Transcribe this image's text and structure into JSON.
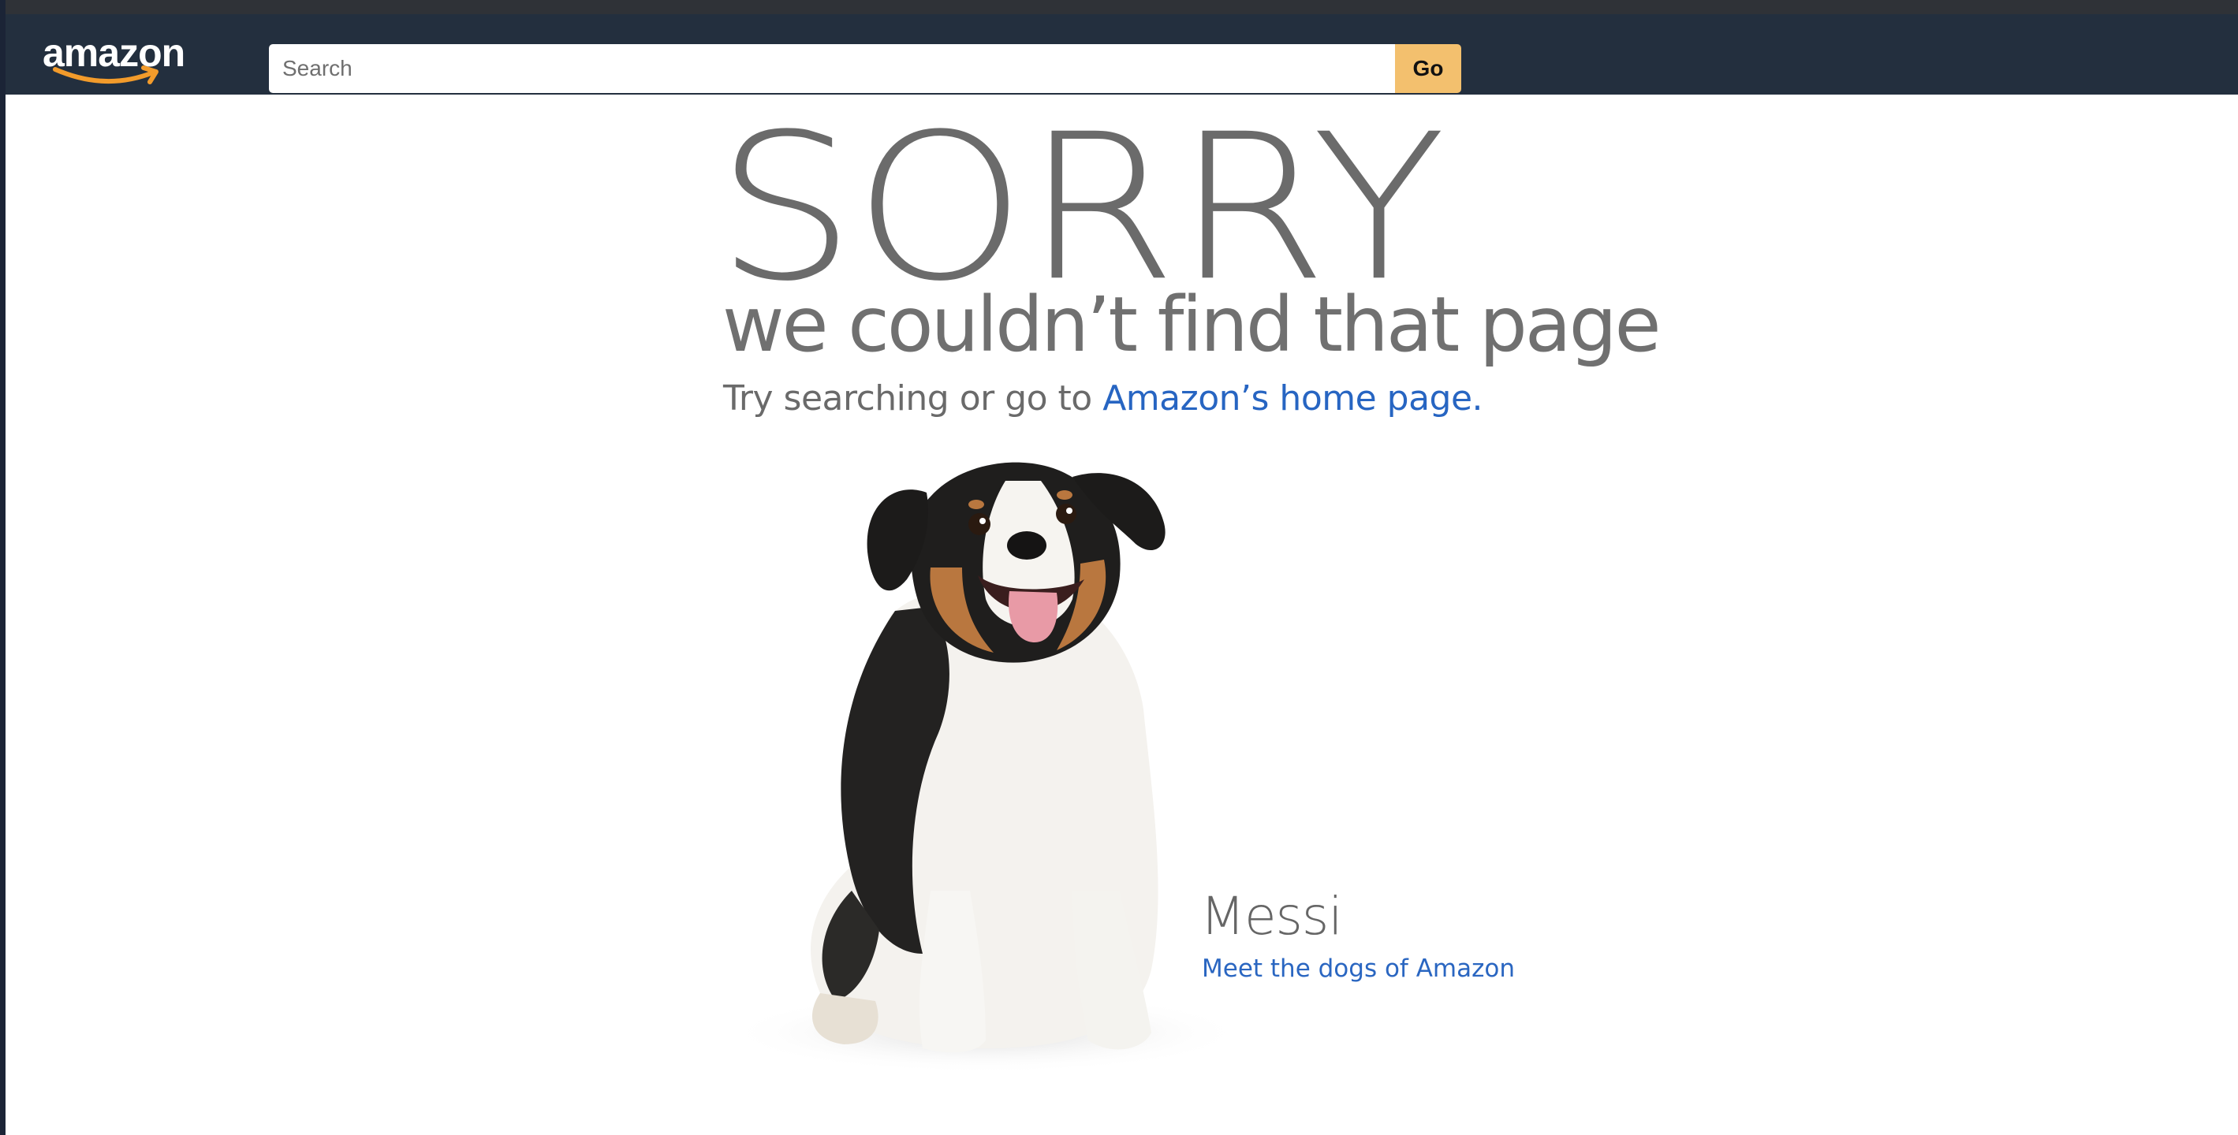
{
  "header": {
    "logo_text": "amazon",
    "search": {
      "placeholder": "Search",
      "value": ""
    },
    "go_label": "Go"
  },
  "main": {
    "title": "SORRY",
    "subtitle": "we couldn’t find that page",
    "try_text": "Try searching or go to ",
    "home_link": "Amazon’s home page."
  },
  "dog": {
    "name": "Messi",
    "link": "Meet the dogs of Amazon"
  },
  "colors": {
    "navbar": "#232f3e",
    "go_button": "#f3c06e",
    "link": "#2765c2",
    "heading_gray": "#6b6b6b"
  },
  "icons": [
    "amazon-logo",
    "amazon-smile"
  ]
}
